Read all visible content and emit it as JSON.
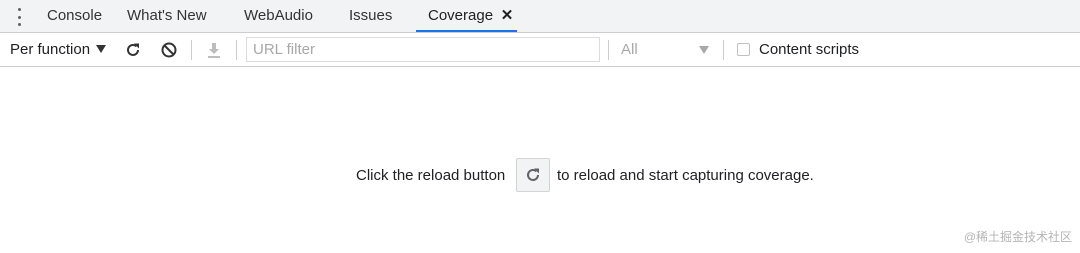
{
  "tabs": {
    "items": [
      {
        "label": "Console"
      },
      {
        "label": "What's New"
      },
      {
        "label": "WebAudio"
      },
      {
        "label": "Issues"
      },
      {
        "label": "Coverage",
        "active": true
      }
    ],
    "close_glyph": "✕",
    "accent_color": "#1a73e8"
  },
  "toolbar": {
    "mode_label": "Per function",
    "icons": [
      "reload-icon",
      "clear-icon",
      "download-icon"
    ],
    "url_filter_placeholder": "URL filter",
    "url_filter_value": "",
    "type_filter_value": "All",
    "content_scripts_label": "Content scripts",
    "content_scripts_checked": false
  },
  "landing": {
    "message_before": "Click the reload button",
    "message_after": "to reload and start capturing coverage.",
    "button_icon": "reload-icon"
  },
  "watermark": "@稀土掘金技术社区"
}
